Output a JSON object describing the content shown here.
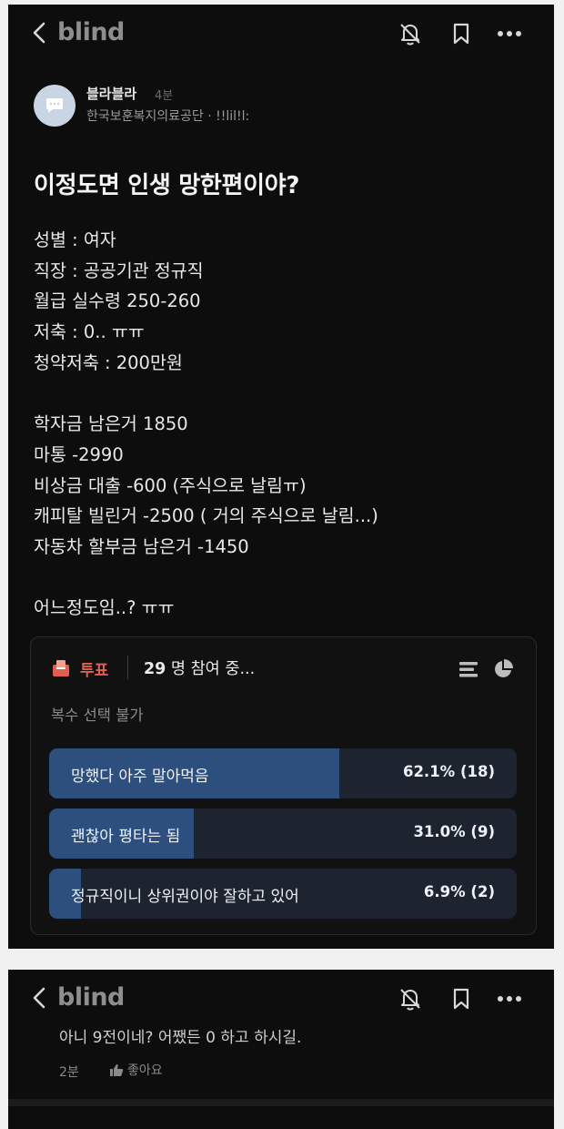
{
  "app": {
    "logo": "blind"
  },
  "post": {
    "author": "블라블라",
    "time": "4분",
    "company": "한국보훈복지의료공단 · !!lil!l:",
    "title": "이정도면 인생 망한편이야?",
    "lines": [
      "성별 : 여자",
      "직장 : 공공기관 정규직",
      "월급 실수령 250-260",
      "저축 : 0.. ㅠㅠ",
      "청약저축 : 200만원",
      "",
      "학자금 남은거 1850",
      "마통 -2990",
      "비상금 대출 -600 (주식으로 날림ㅠ)",
      "캐피탈 빌린거 -2500 ( 거의 주식으로 날림...)",
      "자동차 할부금 남은거 -1450",
      "",
      "어느정도임..? ㅠㅠ"
    ]
  },
  "poll": {
    "label": "투표",
    "count": "29",
    "count_suffix": " 명 참여 중...",
    "subtitle": "복수 선택 불가",
    "options": [
      {
        "label": "망했다 아주 말아먹음",
        "percent": 62.1,
        "result": "62.1% (18)"
      },
      {
        "label": "괜찮아 평타는 됨",
        "percent": 31.0,
        "result": "31.0% (9)"
      },
      {
        "label": "정규직이니 상위권이야 잘하고 있어",
        "percent": 6.9,
        "result": "6.9% (2)"
      }
    ]
  },
  "screen2": {
    "comment": "아니 9전이네? 어쨌든 0 하고 하시길.",
    "time": "2분",
    "like_label": "좋아요"
  },
  "icons": [
    "back-chevron-icon",
    "bell-off-icon",
    "bookmark-icon",
    "more-icon",
    "chat-bubble-icon",
    "ballot-box-icon",
    "bar-list-icon",
    "pie-chart-icon",
    "thumbs-up-icon"
  ],
  "colors": {
    "background": "#0d0d0d",
    "poll_accent": "#e0604f",
    "bar_fill": "#2d4f7e",
    "bar_track": "#1d2430"
  }
}
